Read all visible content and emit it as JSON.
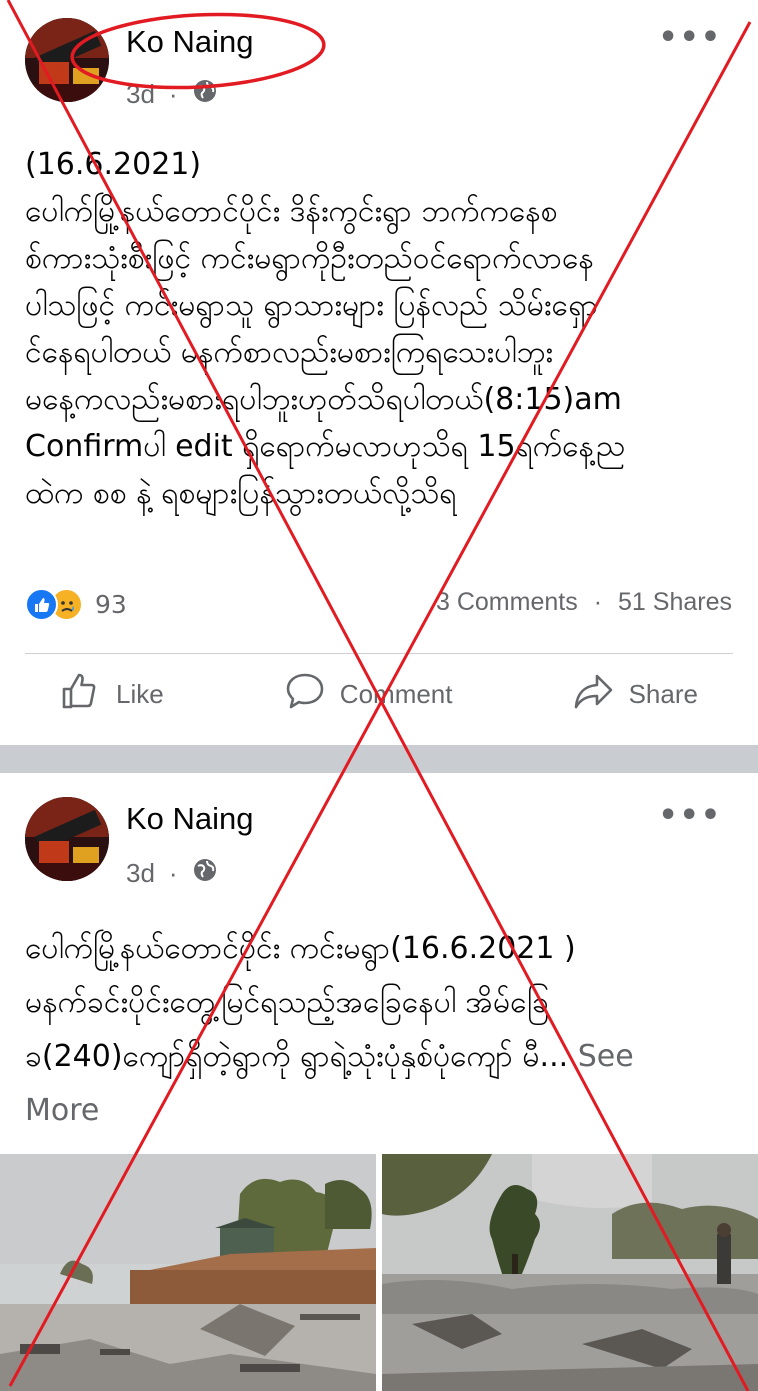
{
  "posts": [
    {
      "author": "Ko Naing",
      "time": "3d",
      "dot": "·",
      "more": "•••",
      "lines": [
        "(16.6.2021)",
        "ပေါက်မြို့နယ်တောင်ပိုင်း ဒိန်းကွင်းရွာ ဘက်ကနေစ",
        "စ်ကားသုံးစီးဖြင့် ကင်းမရွာကိုဦးတည်ဝင်ရောက်လာနေ",
        "ပါသဖြင့် ကင်းမရွာသူ ရွာသားများ ပြန်လည် သိမ်းရှော",
        "င်နေရပါတယ် မနက်စာလည်းမစားကြရသေးပါဘူး",
        "မနေ့ကလည်းမစားရပါဘူးဟုတ်သိရပါတယ်(8:15)am",
        "Confirmပါ edit ရှိရောက်မလာဟုသိရ 15ရက်နေ့ည",
        "ထဲက စစ နဲ့ ရစများပြန်သွားတယ်လို့သိရ"
      ],
      "reaction_count": "93",
      "comments": "3 Comments",
      "shares": "51 Shares",
      "stats_dot": "·",
      "actions": {
        "like": "Like",
        "comment": "Comment",
        "share": "Share"
      }
    },
    {
      "author": "Ko Naing",
      "time": "3d",
      "dot": "·",
      "more": "•••",
      "lines": [
        "ပေါက်မြို့နယ်တောင်ပိုင်း ကင်းမရွာ(16.6.2021 )",
        "မနက်ခင်းပိုင်းတွေ့မြင်ရသည့်အခြေနေပါ အိမ်ခြေ",
        "ခ(240)ကျော်ရှိတဲ့ရွာကို ရွာရဲ့သုံးပုံနှစ်ပုံကျော် မီ..."
      ],
      "see_more_inline": "See",
      "see_more_wrap": "More"
    }
  ],
  "colors": {
    "cross": "#e21a22",
    "highlight_circle": "#e21a22",
    "like_blue": "#1877f2",
    "sad_yellow": "#f7b125",
    "secondary_text": "#65676b",
    "separator": "#c9ccd1"
  },
  "icons": [
    "globe-icon",
    "more-options-icon",
    "like-reaction-icon",
    "sad-reaction-icon",
    "thumbs-up-icon",
    "comment-bubble-icon",
    "share-arrow-icon"
  ]
}
